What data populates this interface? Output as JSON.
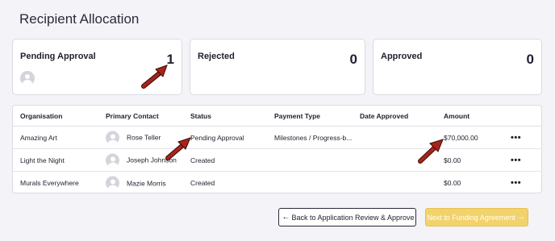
{
  "page": {
    "title": "Recipient Allocation"
  },
  "cards": [
    {
      "label": "Pending Approval",
      "count": "1"
    },
    {
      "label": "Rejected",
      "count": "0"
    },
    {
      "label": "Approved",
      "count": "0"
    }
  ],
  "table": {
    "headers": [
      "Organisation",
      "Primary Contact",
      "Status",
      "Payment Type",
      "Date Approved",
      "Amount"
    ],
    "rows": [
      {
        "organisation": "Amazing Art",
        "contact": "Rose Teller",
        "status": "Pending Approval",
        "payment_type": "Milestones / Progress-b...",
        "date_approved": "",
        "amount": "$70,000.00",
        "menu": "•••"
      },
      {
        "organisation": "Light the Night",
        "contact": "Joseph Johnson",
        "status": "Created",
        "payment_type": "",
        "date_approved": "",
        "amount": "$0.00",
        "menu": "•••"
      },
      {
        "organisation": "Murals Everywhere",
        "contact": "Mazie Morris",
        "status": "Created",
        "payment_type": "",
        "date_approved": "",
        "amount": "$0.00",
        "menu": "•••"
      }
    ]
  },
  "buttons": {
    "back_label": "Back to Application Review & Approve",
    "back_icon": "←",
    "next_label": "Next to Funding Agreement",
    "next_icon": "→"
  },
  "colors": {
    "annotation_arrow": "#a8241a",
    "next_button": "#f2d26b"
  }
}
